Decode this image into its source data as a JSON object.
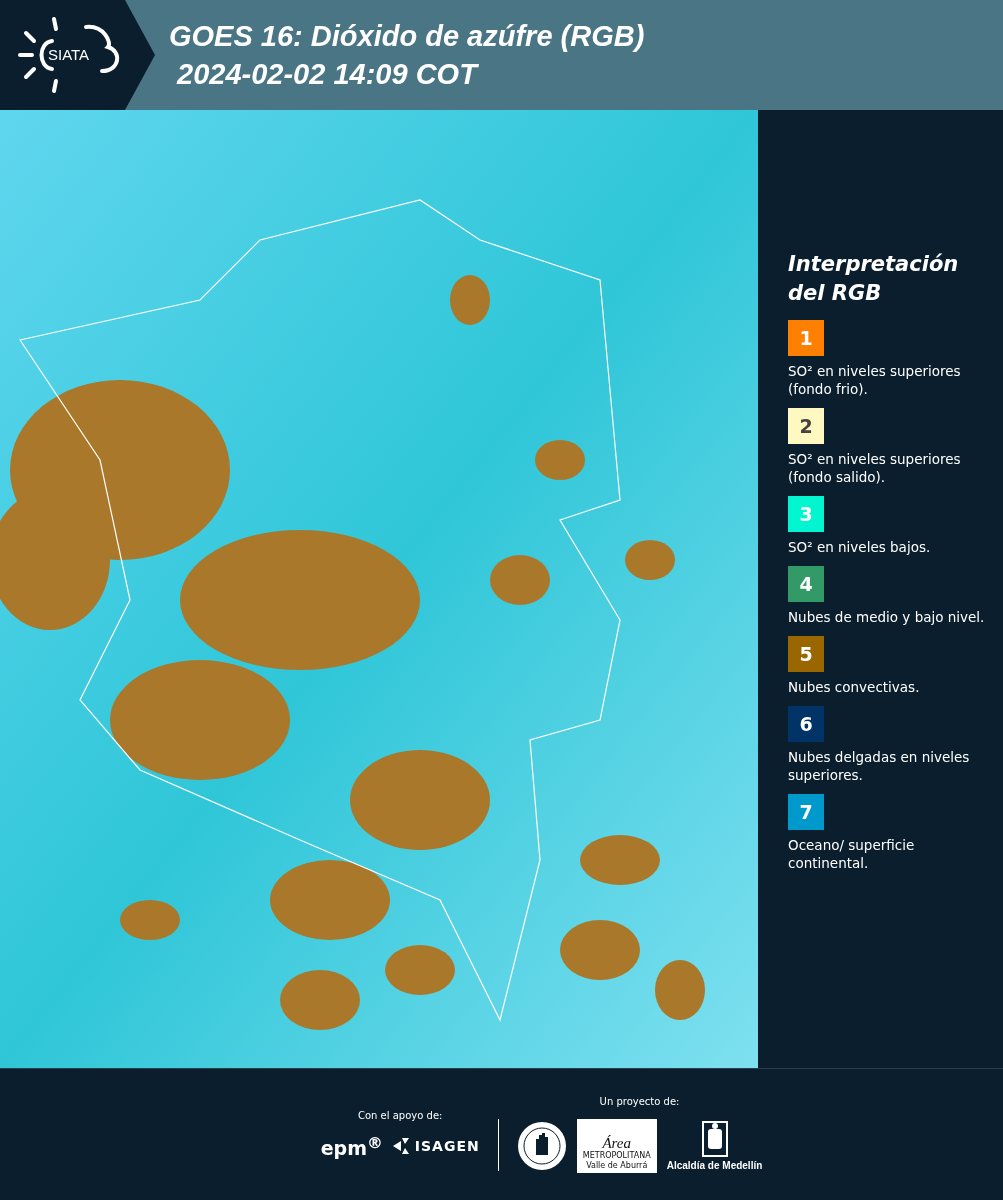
{
  "header": {
    "logo_text": "SIATA",
    "title": "GOES 16: Dióxido de azúfre (RGB)",
    "timestamp": "2024-02-02 14:09 COT"
  },
  "legend": {
    "title": "Interpretación del RGB",
    "items": [
      {
        "number": "1",
        "color": "#ff7f00",
        "text": "SO² en niveles superiores (fondo frio)."
      },
      {
        "number": "2",
        "color": "#fff8c0",
        "text": "SO² en niveles superiores (fondo salido)."
      },
      {
        "number": "3",
        "color": "#00f5d0",
        "text": "SO² en niveles bajos."
      },
      {
        "number": "4",
        "color": "#339966",
        "text": "Nubes de medio y bajo nivel."
      },
      {
        "number": "5",
        "color": "#996600",
        "text": "Nubes convectivas."
      },
      {
        "number": "6",
        "color": "#003366",
        "text": "Nubes delgadas en niveles superiores."
      },
      {
        "number": "7",
        "color": "#0099cc",
        "text": "Oceano/ superficie continental."
      }
    ]
  },
  "footer": {
    "support_label": "Con el apoyo de:",
    "support_logos": [
      "epm$^{®}$",
      "ISAGEN"
    ],
    "project_label": "Un proyecto de:",
    "area_logo": {
      "title": "Área",
      "line_1": "METROPOLITANA",
      "line_2": "Valle de Aburrá"
    },
    "alcaldia_label": "Alcaldía de Medellín"
  }
}
